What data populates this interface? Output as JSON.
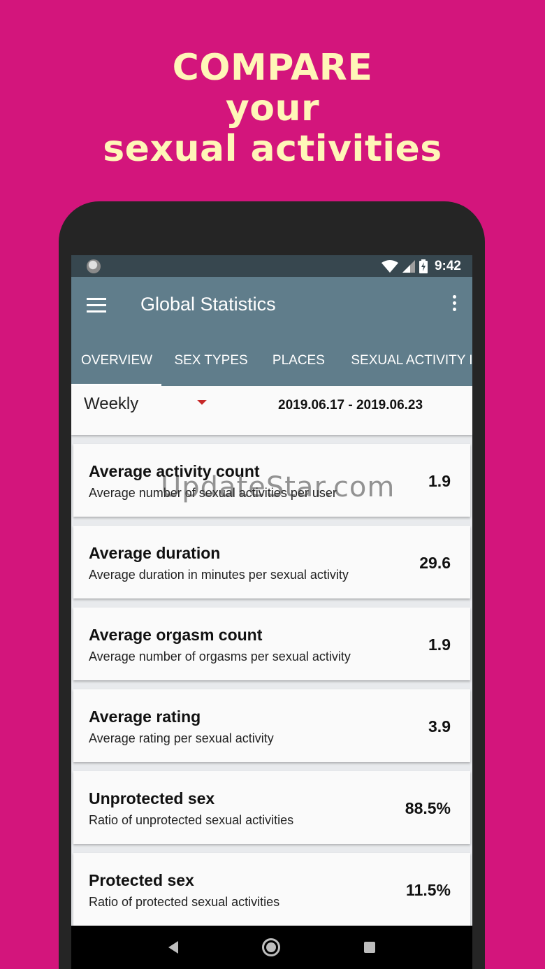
{
  "promo": {
    "line1": "COMPARE",
    "line2": "your",
    "line3": "sexual activities"
  },
  "status_bar": {
    "time": "9:42",
    "icons": [
      "notification-dot-icon",
      "wifi-icon",
      "signal-icon",
      "battery-charging-icon"
    ]
  },
  "app_bar": {
    "title": "Global Statistics",
    "menu_icon": "hamburger-menu-icon",
    "overflow_icon": "more-vertical-icon"
  },
  "tabs": [
    {
      "label": "OVERVIEW",
      "active": true
    },
    {
      "label": "SEX TYPES",
      "active": false
    },
    {
      "label": "PLACES",
      "active": false
    },
    {
      "label": "SEXUAL ACTIVITY IN",
      "active": false
    }
  ],
  "filter": {
    "period": "Weekly",
    "date_range": "2019.06.17 - 2019.06.23"
  },
  "stats": [
    {
      "title": "Average activity count",
      "description": "Average number of sexual activities per user",
      "value": "1.9"
    },
    {
      "title": "Average duration",
      "description": "Average duration in minutes per sexual activity",
      "value": "29.6"
    },
    {
      "title": "Average orgasm count",
      "description": "Average number of orgasms per sexual activity",
      "value": "1.9"
    },
    {
      "title": "Average rating",
      "description": "Average rating per sexual activity",
      "value": "3.9"
    },
    {
      "title": "Unprotected sex",
      "description": "Ratio of unprotected sexual activities",
      "value": "88.5%"
    },
    {
      "title": "Protected sex",
      "description": "Ratio of protected sexual activities",
      "value": "11.5%"
    }
  ],
  "watermark": "UpdateStar.com",
  "colors": {
    "background": "#d3157c",
    "promo_text": "#fff6b8",
    "app_bar": "#607d8b",
    "status_bar": "#37474f",
    "dropdown_accent": "#c62828"
  }
}
